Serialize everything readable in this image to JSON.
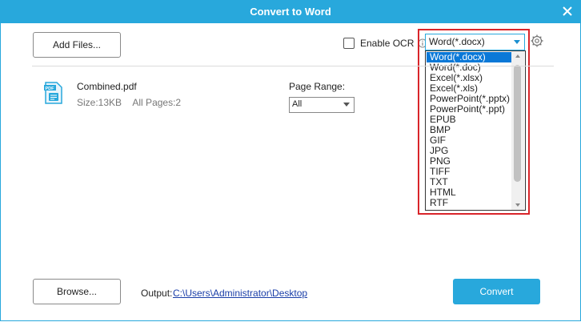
{
  "window": {
    "title": "Convert to Word"
  },
  "toolbar": {
    "add_files_label": "Add Files..."
  },
  "ocr": {
    "label": "Enable OCR",
    "checked": false
  },
  "format": {
    "selected": "Word(*.docx)",
    "options": [
      "Word(*.docx)",
      "Word(*.doc)",
      "Excel(*.xlsx)",
      "Excel(*.xls)",
      "PowerPoint(*.pptx)",
      "PowerPoint(*.ppt)",
      "EPUB",
      "BMP",
      "GIF",
      "JPG",
      "PNG",
      "TIFF",
      "TXT",
      "HTML",
      "RTF"
    ],
    "highlighted_index": 0
  },
  "file": {
    "name": "Combined.pdf",
    "size": "Size:13KB",
    "pages": "All Pages:2",
    "icon": "pdf-file-icon"
  },
  "page_range": {
    "label": "Page Range:",
    "value": "All"
  },
  "footer": {
    "browse_label": "Browse...",
    "output_label": "Output:",
    "output_path": "C:\\Users\\Administrator\\Desktop",
    "convert_label": "Convert"
  },
  "colors": {
    "accent": "#28a8dc",
    "highlight_border": "#d9252a",
    "selected_item": "#0a78d7"
  }
}
